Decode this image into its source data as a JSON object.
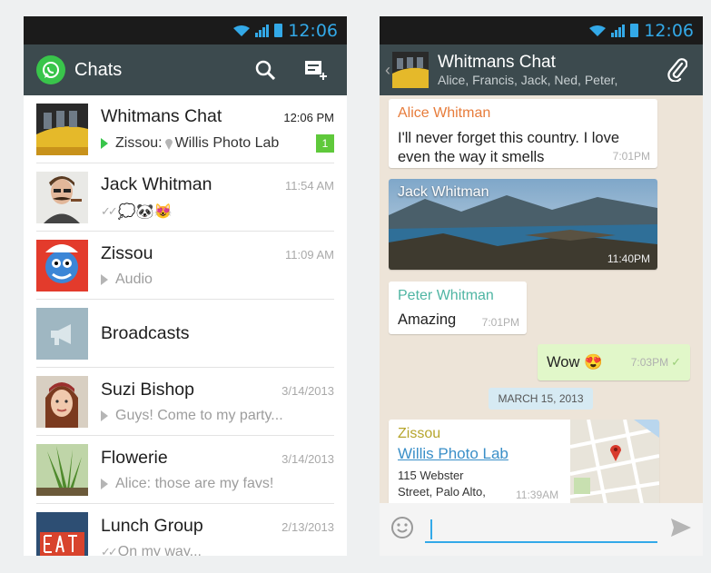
{
  "status": {
    "time": "12:06"
  },
  "chats_screen": {
    "title": "Chats",
    "icons": {
      "search": "search-icon",
      "new_chat": "new-chat-icon"
    },
    "rows": [
      {
        "name": "Whitmans Chat",
        "time": "12:06 PM",
        "preview_sender": "Zissou:",
        "preview": "Willis Photo Lab",
        "unread": "1",
        "avatar": "bus-photo"
      },
      {
        "name": "Jack Whitman",
        "time": "11:54 AM",
        "preview": "💭🐼😻",
        "avatar": "mustache-man-photo"
      },
      {
        "name": "Zissou",
        "time": "11:09 AM",
        "preview": "Audio",
        "avatar": "blue-cartoon-photo"
      },
      {
        "name": "Broadcasts",
        "avatar": "megaphone-icon"
      },
      {
        "name": "Suzi Bishop",
        "time": "3/14/2013",
        "preview": "Guys! Come to my party...",
        "avatar": "woman-photo"
      },
      {
        "name": "Flowerie",
        "time": "3/14/2013",
        "preview": "Alice: those are my favs!",
        "avatar": "plant-photo"
      },
      {
        "name": "Lunch Group",
        "time": "2/13/2013",
        "preview": "On my way...",
        "avatar": "eat-sign-photo"
      }
    ]
  },
  "conversation": {
    "title": "Whitmans Chat",
    "participants": "Alice, Francis, Jack, Ned, Peter,",
    "messages": [
      {
        "sender": "Alice Whitman",
        "sender_color": "#e77c3b",
        "text": "I'll never forget this country. I love even the way it smells",
        "time": "7:01PM"
      },
      {
        "sender": "Jack Whitman",
        "type": "image",
        "time": "11:40PM"
      },
      {
        "sender": "Peter Whitman",
        "sender_color": "#4fb5a3",
        "text": "Amazing",
        "time": "7:01PM"
      },
      {
        "outgoing": true,
        "text": "Wow 😍",
        "time": "7:03PM"
      }
    ],
    "date_divider": "MARCH 15, 2013",
    "location_message": {
      "sender": "Zissou",
      "sender_color": "#b6a52c",
      "place_name": "Willis Photo Lab",
      "address_1": "115 Webster",
      "address_2": "Street, Palo Alto,",
      "time": "11:39AM"
    },
    "composer": {
      "placeholder": ""
    }
  },
  "colors": {
    "appbar": "#3c4a4e",
    "accent": "#33a9e8",
    "whatsapp_green": "#39c54b",
    "unread_badge": "#5fc93b"
  }
}
